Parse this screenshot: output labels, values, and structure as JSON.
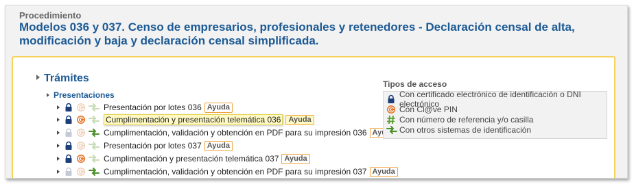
{
  "header": {
    "label": "Procedimiento",
    "title": "Modelos 036 y 037. Censo de empresarios, profesionales y retenedores - Declaración censal de alta, modificación y baja y declaración censal simplificada."
  },
  "tree": {
    "section": "Trámites",
    "subsection": "Presentaciones",
    "help_label": "Ayuda",
    "items": [
      {
        "label": "Presentación por lotes 036",
        "icons": [
          "lock",
          "clave-faded",
          "arrows-faded"
        ]
      },
      {
        "label": "Cumplimentación y presentación telemática 036",
        "icons": [
          "lock",
          "clave",
          "arrows-faded"
        ],
        "highlighted": true
      },
      {
        "label": "Cumplimentación, validación y obtención en PDF para su impresión 036",
        "icons": [
          "lock-faded",
          "clave-faded",
          "arrows"
        ]
      },
      {
        "label": "Presentación por lotes 037",
        "icons": [
          "lock",
          "clave-faded",
          "arrows-faded"
        ]
      },
      {
        "label": "Cumplimentación y presentación telemática 037",
        "icons": [
          "lock",
          "clave",
          "arrows-faded"
        ]
      },
      {
        "label": "Cumplimentación, validación y obtención en PDF para su impresión 037",
        "icons": [
          "lock-faded",
          "clave-faded",
          "arrows"
        ]
      }
    ]
  },
  "access_types": {
    "title": "Tipos de acceso",
    "items": [
      {
        "icon": "lock-icon",
        "label": "Con certificado electrónico de identificación o DNI electrónico"
      },
      {
        "icon": "clave-icon",
        "label": "Con Cl@ve PIN"
      },
      {
        "icon": "hash-icon",
        "label": "Con número de referencia y/o casilla"
      },
      {
        "icon": "arrows-icon",
        "label": "Con otros sistemas de identificación"
      }
    ]
  },
  "colors": {
    "title_blue": "#1c5a95",
    "lock_blue": "#1c3f7a",
    "clave_orange": "#e8752a",
    "hash_green": "#5a9e2f",
    "arrows_green": "#4a8f2a",
    "panel_border": "#f5d35a"
  }
}
